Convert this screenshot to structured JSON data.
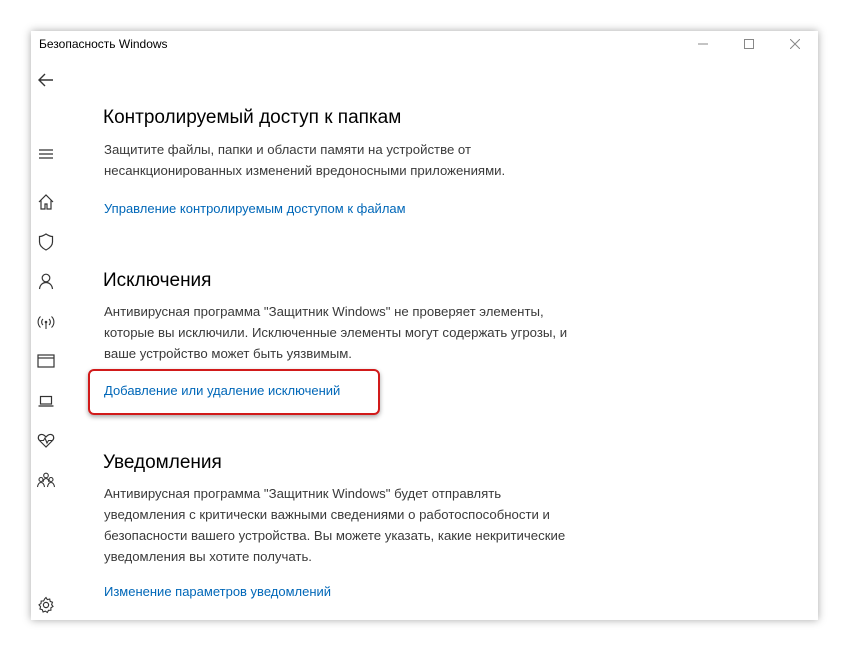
{
  "window": {
    "title": "Безопасность Windows",
    "controls": {
      "minimize": "minimize-icon",
      "maximize": "maximize-icon",
      "close": "close-icon"
    }
  },
  "nav": {
    "items": [
      "back-arrow-icon",
      "hamburger-menu-icon",
      "home-icon",
      "shield-icon",
      "person-icon",
      "wifi-icon",
      "browser-icon",
      "laptop-icon",
      "heart-icon",
      "family-icon",
      "gear-icon"
    ]
  },
  "sections": {
    "controlled_access": {
      "title": "Контролируемый доступ к папкам",
      "description": "Защитите файлы, папки и области памяти на устройстве от несанкционированных изменений вредоносными приложениями.",
      "link": "Управление контролируемым доступом к файлам"
    },
    "exclusions": {
      "title": "Исключения",
      "description": "Антивирусная программа \"Защитник Windows\" не проверяет элементы, которые вы исключили. Исключенные элементы могут содержать угрозы, и ваше устройство может быть уязвимым.",
      "link": "Добавление или удаление исключений"
    },
    "notifications": {
      "title": "Уведомления",
      "description": "Антивирусная программа \"Защитник Windows\" будет отправлять уведомления с критически важными сведениями о работоспособности и безопасности вашего устройства. Вы можете указать, какие некритические уведомления вы хотите получать.",
      "link": "Изменение параметров уведомлений"
    }
  },
  "colors": {
    "link": "#0067b8",
    "highlight": "#d11a1a",
    "icon": "#333333"
  }
}
